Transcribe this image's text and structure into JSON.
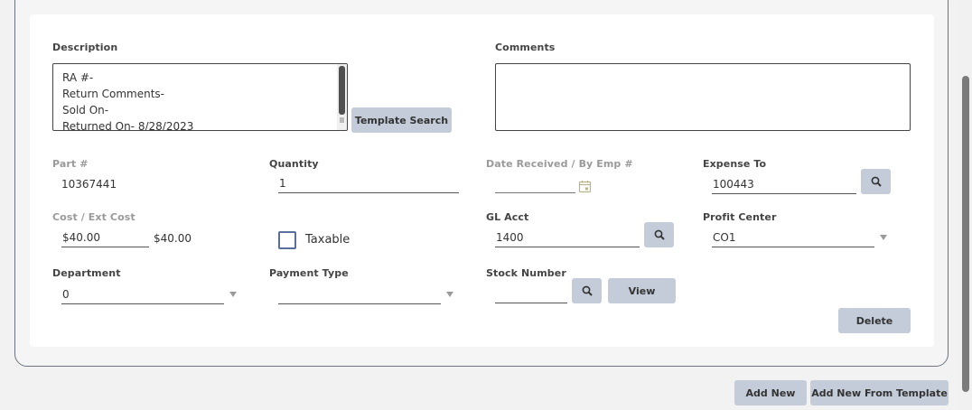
{
  "form": {
    "description": {
      "label": "Description",
      "lines": [
        "RA #-",
        "Return Comments-",
        "Sold On-",
        "Returned On- 8/28/2023"
      ]
    },
    "template_search_label": "Template Search",
    "comments": {
      "label": "Comments",
      "value": ""
    },
    "part": {
      "label": "Part #",
      "value": "10367441"
    },
    "quantity": {
      "label": "Quantity",
      "value": "1"
    },
    "date_received": {
      "label": "Date Received / By Emp #",
      "value": ""
    },
    "expense_to": {
      "label": "Expense To",
      "value": "100443"
    },
    "cost": {
      "label": "Cost / Ext Cost",
      "value": "$40.00",
      "ext_value": "$40.00"
    },
    "taxable": {
      "label": "Taxable",
      "checked": false
    },
    "gl_acct": {
      "label": "GL Acct",
      "value": "1400"
    },
    "profit_center": {
      "label": "Profit Center",
      "value": "CO1"
    },
    "department": {
      "label": "Department",
      "value": "0"
    },
    "payment_type": {
      "label": "Payment Type",
      "value": ""
    },
    "stock_number": {
      "label": "Stock Number",
      "value": ""
    },
    "view_label": "View",
    "delete_label": "Delete"
  },
  "footer": {
    "add_new_label": "Add New",
    "add_new_from_template_label": "Add New From Template"
  },
  "icons": {
    "lookup": "search-icon",
    "date": "calendar-icon",
    "dropdown": "chevron-down-icon"
  }
}
